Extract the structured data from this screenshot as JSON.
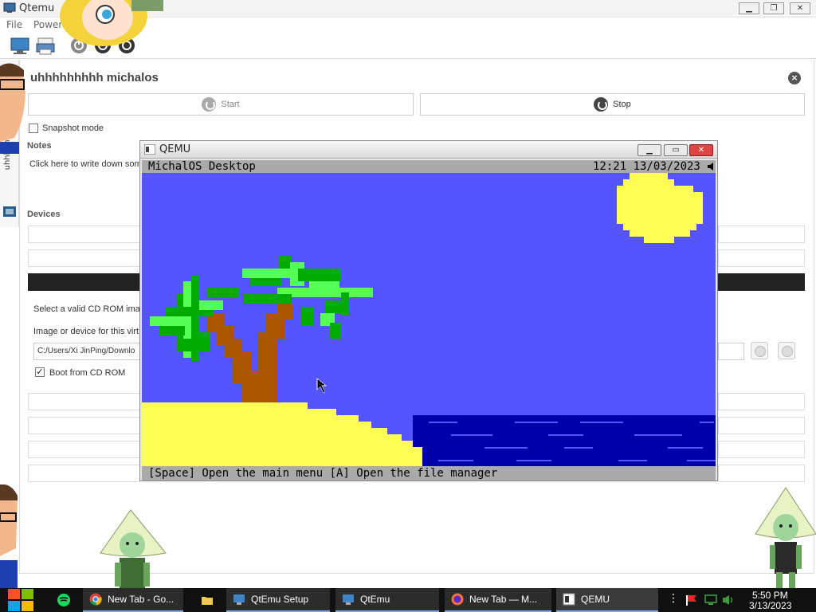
{
  "qtemu": {
    "title": "Qtemu",
    "menu": [
      "File",
      "Power"
    ],
    "machine_name": "uhhhhhhhhh michalos",
    "start_label": "Start",
    "stop_label": "Stop",
    "snapshot_label": "Snapshot mode",
    "notes_heading": "Notes",
    "notes_placeholder": "Click here to write down some",
    "devices_heading": "Devices",
    "cdrom_hint": "Select a valid CD ROM image",
    "image_device_label": "Image or device for this virt",
    "cdrom_path": "C:/Users/Xi JinPing/Downlo",
    "boot_cdrom_label": "Boot from CD ROM",
    "sidebar_label": "uhhhhhhhhh"
  },
  "qemu": {
    "title": "QEMU",
    "os_title": "MichalOS Desktop",
    "os_clock": "12:21 13/03/2023",
    "os_statusbar": "[Space] Open the main menu [A] Open the file manager"
  },
  "taskbar": {
    "items": [
      {
        "label": "New Tab - Go...",
        "icon": "chrome-icon"
      },
      {
        "label": "",
        "icon": "folder-icon"
      },
      {
        "label": "QtEmu Setup",
        "icon": "setup-icon"
      },
      {
        "label": "QtEmu",
        "icon": "qtemu-icon"
      },
      {
        "label": "New Tab — M...",
        "icon": "firefox-icon"
      },
      {
        "label": "QEMU",
        "icon": "qemu-icon"
      }
    ],
    "time": "5:50 PM",
    "date": "3/13/2023"
  },
  "colors": {
    "sky": "#5555ff",
    "sea": "#0000aa",
    "sand": "#ffff55",
    "sun": "#ffff55",
    "trunk": "#aa5500",
    "leaf_dark": "#00aa00",
    "leaf_light": "#55ff55",
    "bar": "#aaaaaa"
  }
}
